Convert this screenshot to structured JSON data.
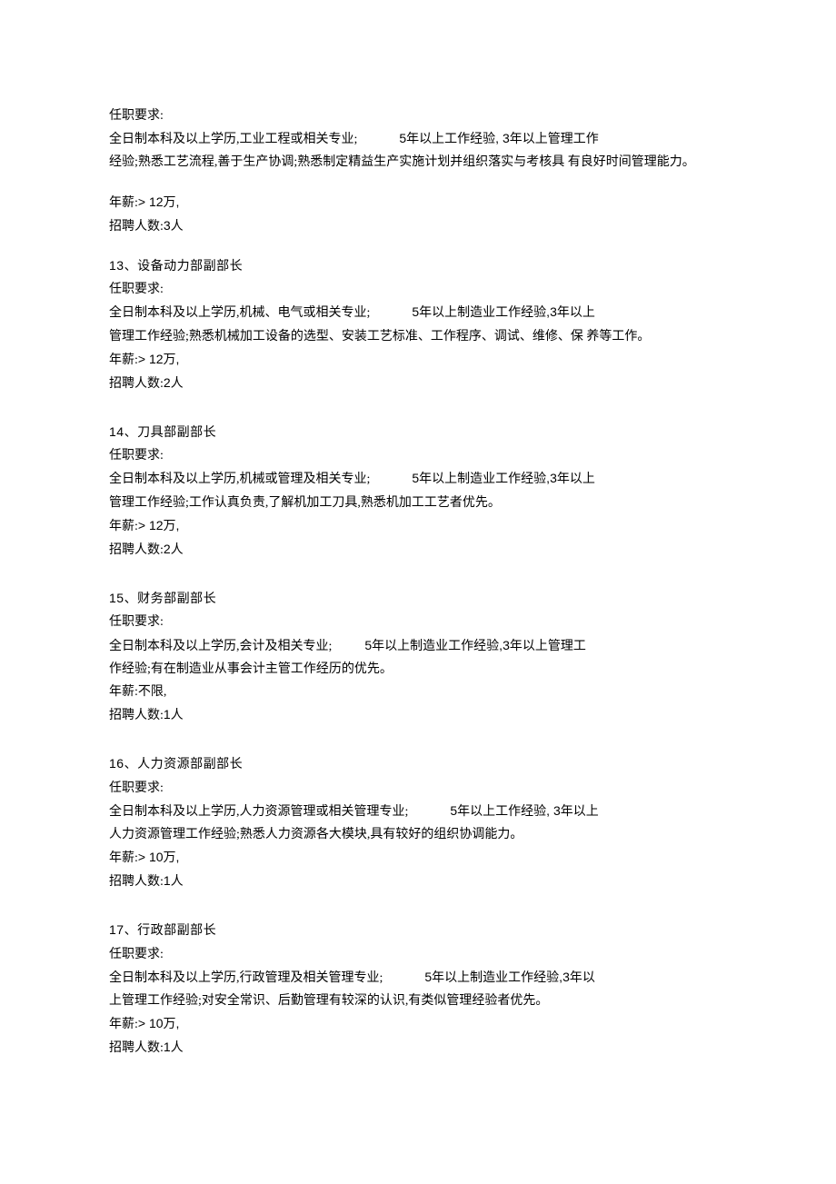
{
  "job12": {
    "req_label": "任职要求:",
    "req_line1a": "全日制本科及以上学历,工业工程或相关专业;",
    "req_line1b": "5年以上工作经验, 3年以上管理工作",
    "req_line2": "经验;熟悉工艺流程,善于生产协调;熟悉制定精益生产实施计划并组织落实与考核具 有良好时间管理能力。",
    "salary_label": "年薪:",
    "salary_value": "> 12万,",
    "count_label": "招聘人数:",
    "count_value": "3人"
  },
  "job13": {
    "number": "13、",
    "title": "设备动力部副部长",
    "req_label": "任职要求:",
    "req_line1a": "全日制本科及以上学历,机械、电气或相关专业;",
    "req_line1b": "5年以上制造业工作经验,3年以上",
    "req_line2": "管理工作经验;熟悉机械加工设备的选型、安装工艺标准、工作程序、调试、维修、保 养等工作。",
    "salary_label": "年薪:",
    "salary_value": "> 12万,",
    "count_label": "招聘人数:",
    "count_value": "2人"
  },
  "job14": {
    "number": "14、",
    "title": "刀具部副部长",
    "req_label": "任职要求:",
    "req_line1a": "全日制本科及以上学历,机械或管理及相关专业;",
    "req_line1b": "5年以上制造业工作经验,3年以上",
    "req_line2": "管理工作经验;工作认真负责,了解机加工刀具,熟悉机加工工艺者优先。",
    "salary_label": "年薪:",
    "salary_value": "> 12万,",
    "count_label": "招聘人数:",
    "count_value": "2人"
  },
  "job15": {
    "number": "15、",
    "title": "财务部副部长",
    "req_label": "任职要求:",
    "req_line1a": "全日制本科及以上学历,会计及相关专业;",
    "req_line1b": "5年以上制造业工作经验,3年以上管理工",
    "req_line2": "作经验;有在制造业从事会计主管工作经历的优先。",
    "salary_label": "年薪:",
    "salary_value": "不限,",
    "count_label": "招聘人数:",
    "count_value": "1人"
  },
  "job16": {
    "number": "16、",
    "title": "人力资源部副部长",
    "req_label": "任职要求:",
    "req_line1a": "全日制本科及以上学历,人力资源管理或相关管理专业;",
    "req_line1b": "5年以上工作经验, 3年以上",
    "req_line2": "人力资源管理工作经验;熟悉人力资源各大模块,具有较好的组织协调能力。",
    "salary_label": "年薪:",
    "salary_value": "> 10万,",
    "count_label": "招聘人数:",
    "count_value": "1人"
  },
  "job17": {
    "number": "17、",
    "title": "行政部副部长",
    "req_label": "任职要求:",
    "req_line1a": "全日制本科及以上学历,行政管理及相关管理专业;",
    "req_line1b": "5年以上制造业工作经验,3年以",
    "req_line2": "上管理工作经验;对安全常识、后勤管理有较深的认识,有类似管理经验者优先。",
    "salary_label": "年薪:",
    "salary_value": "> 10万,",
    "count_label": "招聘人数:",
    "count_value": "1人"
  }
}
